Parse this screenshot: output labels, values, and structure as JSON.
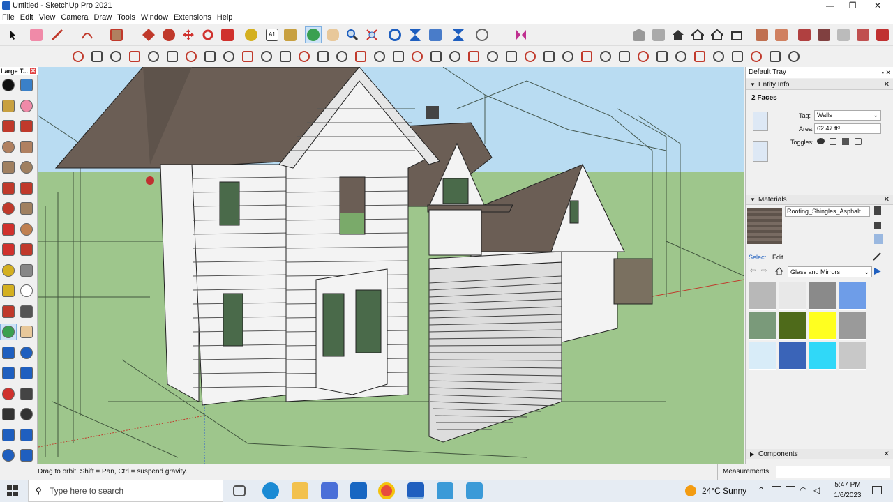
{
  "window": {
    "title": "Untitled - SketchUp Pro 2021",
    "controls": [
      "—",
      "❐",
      "✕"
    ]
  },
  "menu": [
    "File",
    "Edit",
    "View",
    "Camera",
    "Draw",
    "Tools",
    "Window",
    "Extensions",
    "Help"
  ],
  "left_toolbar": {
    "title": "Large T...",
    "close": "✕"
  },
  "tray": {
    "title": "Default Tray",
    "pin": "▪ ✕",
    "entity_info": {
      "header": "Entity Info",
      "selection": "2 Faces",
      "tag_label": "Tag:",
      "tag_value": "Walls",
      "area_label": "Area:",
      "area_value": "62.47 ft²",
      "toggles_label": "Toggles:"
    },
    "materials": {
      "header": "Materials",
      "current_name": "Roofing_Shingles_Asphalt",
      "tab_select": "Select",
      "tab_edit": "Edit",
      "library": "Glass and Mirrors",
      "swatch_colors": [
        "#b8b8b8",
        "#e8e8e8",
        "#8a8a8a",
        "#6e9de8",
        "#7a9a7a",
        "#4e6a1a",
        "#ffff20",
        "#9a9a9a",
        "#d8ecf8",
        "#3a64b8",
        "#30d8f8",
        "#c8c8c8"
      ]
    },
    "components": {
      "header": "Components"
    }
  },
  "status": {
    "hint": "Drag to orbit. Shift = Pan, Ctrl = suspend gravity.",
    "measurements_label": "Measurements"
  },
  "taskbar": {
    "search_placeholder": "Type here to search",
    "weather": "24°C  Sunny",
    "time": "5:47 PM",
    "date": "1/6/2023"
  },
  "colors": {
    "sky": "#b9dcf2",
    "ground": "#9ec68c",
    "roof": "#6b5e55",
    "siding": "#f3f3f3",
    "accent": "#1f5fbf"
  }
}
